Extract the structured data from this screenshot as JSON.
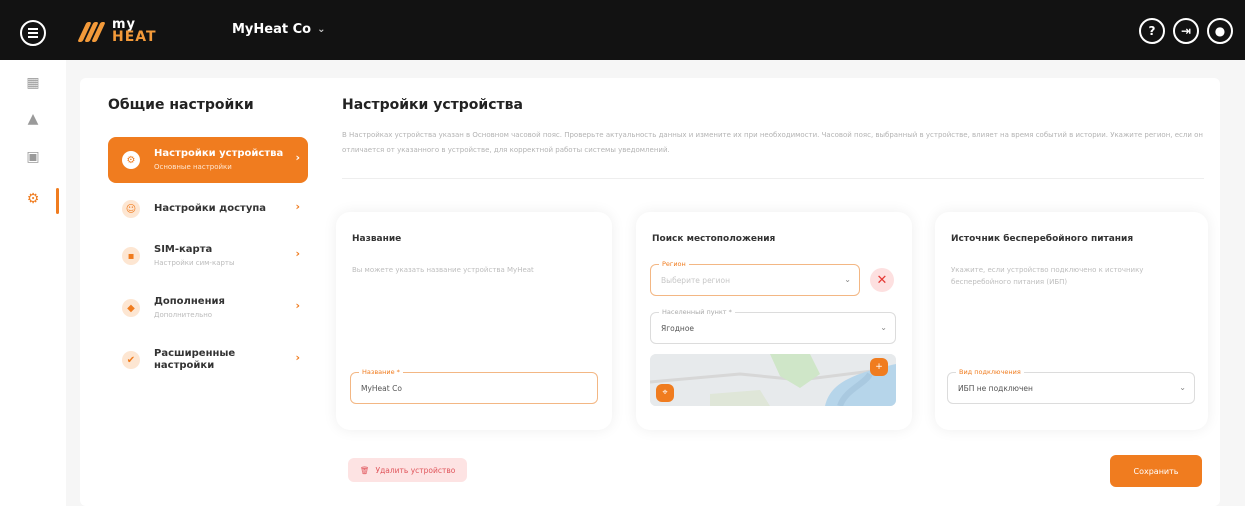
{
  "header": {
    "logo_top": "my",
    "logo_bottom": "HEAT",
    "company": "MyHeat Co",
    "company_chevron": "⌄",
    "icons": [
      "menu-icon",
      "help-icon",
      "login-icon",
      "user-icon"
    ],
    "help_glyph": "?",
    "login_glyph": "⇥",
    "user_glyph": "●"
  },
  "rail": {
    "items": [
      {
        "name": "dashboard-icon",
        "glyph": "▦"
      },
      {
        "name": "warning-icon",
        "glyph": "▲"
      },
      {
        "name": "device-icon",
        "glyph": "▣"
      },
      {
        "name": "settings-icon",
        "glyph": "⚙"
      }
    ]
  },
  "sidebar": {
    "title": "Общие настройки",
    "items": [
      {
        "label": "Настройки устройства",
        "sub": "Основные настройки",
        "active": true,
        "glyph": "⚙"
      },
      {
        "label": "Настройки доступа",
        "sub": "",
        "active": false,
        "glyph": "☺"
      },
      {
        "label": "SIM-карта",
        "sub": "Настройки сим-карты",
        "active": false,
        "glyph": "▪"
      },
      {
        "label": "Дополнения",
        "sub": "Дополнительно",
        "active": false,
        "glyph": "◆"
      },
      {
        "label": "Расширенные настройки",
        "sub": "",
        "active": false,
        "glyph": "✔"
      }
    ],
    "chevron": "›"
  },
  "main": {
    "title": "Настройки устройства",
    "description": "В Настройках устройства указан в Основном часовой пояс. Проверьте актуальность данных и измените их при необходимости. Часовой пояс, выбранный в устройстве, влияет на время событий в истории. Укажите регион, если он отличается от указанного в устройстве, для корректной работы системы уведомлений."
  },
  "cards": {
    "name": {
      "title": "Название",
      "desc": "Вы можете указать название устройства MyHeat",
      "field_label": "Название *",
      "field_value": "MyHeat Co"
    },
    "location": {
      "title": "Поиск местоположения",
      "region_label": "Регион",
      "region_placeholder": "Выберите регион",
      "city_label": "Населенный пункт *",
      "city_value": "Ягодное",
      "clear_glyph": "✕",
      "map_pin_glyph": "⌖",
      "map_zoom_glyph": "+"
    },
    "ups": {
      "title": "Источник бесперебойного питания",
      "desc": "Укажите, если устройство подключено к источнику бесперебойного питания (ИБП)",
      "field_label": "Вид подключения",
      "field_value": "ИБП не подключен",
      "arrow": "⌄"
    }
  },
  "footer": {
    "delete_label": "Удалить устройство",
    "delete_glyph": "🗑",
    "save_label": "Сохранить"
  },
  "colors": {
    "accent": "#f07c1f",
    "topbar": "#121212",
    "danger": "#e0555b"
  }
}
